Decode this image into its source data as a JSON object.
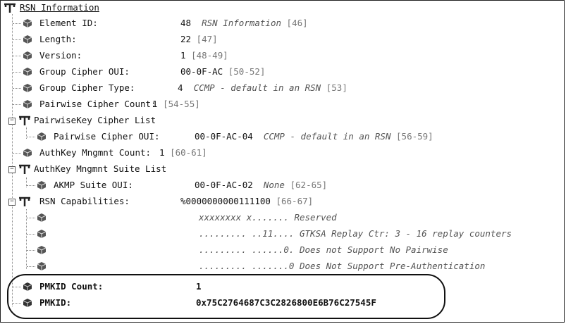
{
  "root": {
    "label": "RSN Information",
    "icon": "tree-branch-icon"
  },
  "rows": [
    {
      "label": "Element ID:",
      "value": "48",
      "desc": "RSN Information",
      "offset": "[46]"
    },
    {
      "label": "Length:",
      "value": "22",
      "desc": "",
      "offset": "[47]"
    },
    {
      "label": "Version:",
      "value": "1",
      "desc": "",
      "offset": "[48-49]"
    },
    {
      "label": "Group Cipher OUI:",
      "value": "00-0F-AC",
      "desc": "",
      "offset": "[50-52]"
    },
    {
      "label": "Group Cipher Type:",
      "value": "4",
      "desc": "CCMP - default in an RSN",
      "offset": "[53]"
    },
    {
      "label": "Pairwise Cipher Count:",
      "value": "1",
      "desc": "",
      "offset": "[54-55]"
    }
  ],
  "pairwise_list": {
    "label": "PairwiseKey Cipher List",
    "child": {
      "label": "Pairwise Cipher OUI:",
      "value": "00-0F-AC-04",
      "desc": "CCMP - default in an RSN",
      "offset": "[56-59]"
    }
  },
  "authkey_count": {
    "label": "AuthKey Mngmnt Count:",
    "value": "1",
    "offset": "[60-61]"
  },
  "authkey_list": {
    "label": "AuthKey Mngmnt Suite List",
    "child": {
      "label": "AKMP Suite OUI:",
      "value": "00-0F-AC-02",
      "desc": "None",
      "offset": "[62-65]"
    }
  },
  "capabilities": {
    "label": "RSN Capabilities:",
    "value": "%0000000000111100",
    "offset": "[66-67]",
    "bits": [
      {
        "mask": "xxxxxxxx x.......",
        "desc": "Reserved"
      },
      {
        "mask": "......... ..11....",
        "desc": "GTKSA Replay Ctr: 3 - 16 replay counters"
      },
      {
        "mask": "......... ......0.",
        "desc": "Does not Support No Pairwise"
      },
      {
        "mask": "......... .......0",
        "desc": "Does Not Support Pre-Authentication"
      }
    ]
  },
  "pmkid_count": {
    "label": "PMKID Count:",
    "value": "1"
  },
  "pmkid": {
    "label": "PMKID:",
    "value": "0x75C2764687C3C2826800E6B76C27545F"
  },
  "icons": {
    "field": "cube-icon",
    "branch": "tree-branch-icon",
    "collapse": "minus-box-icon"
  }
}
